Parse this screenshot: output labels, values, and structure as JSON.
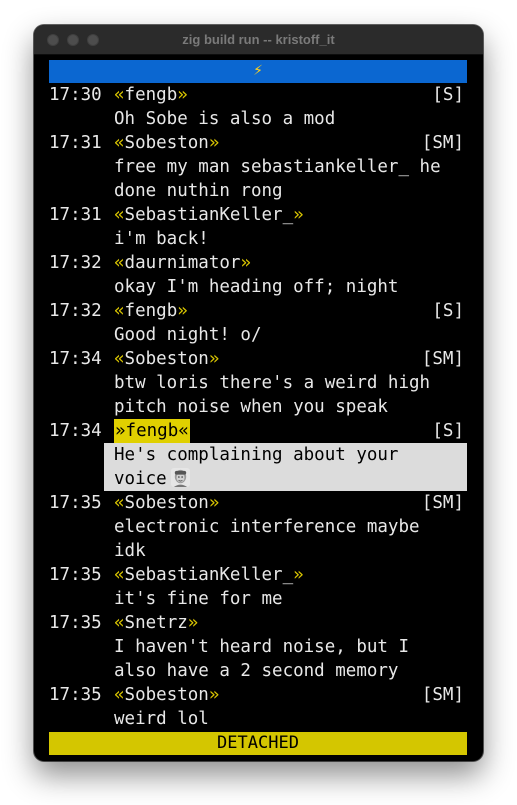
{
  "window": {
    "title": "zig build run -- kristoff_it"
  },
  "top_bar": {
    "icon": "⚡",
    "icon_name": "lightning-icon",
    "color": "#0b67d1"
  },
  "messages": [
    {
      "time": "17:30",
      "nick": "fengb",
      "badge": "[S]",
      "lines": [
        "Oh Sobe is also a mod"
      ]
    },
    {
      "time": "17:31",
      "nick": "Sobeston",
      "badge": "[SM]",
      "lines": [
        "free my man sebastiankeller_ he",
        "done nuthin rong"
      ]
    },
    {
      "time": "17:31",
      "nick": "SebastianKeller_",
      "badge": "",
      "lines": [
        "i'm back!"
      ]
    },
    {
      "time": "17:32",
      "nick": "daurnimator",
      "badge": "",
      "lines": [
        "okay I'm heading off; night"
      ]
    },
    {
      "time": "17:32",
      "nick": "fengb",
      "badge": "[S]",
      "lines": [
        "Good night! o/"
      ]
    },
    {
      "time": "17:34",
      "nick": "Sobeston",
      "badge": "[SM]",
      "lines": [
        "btw loris there's a weird high",
        "pitch noise when you speak"
      ]
    },
    {
      "time": "17:34",
      "nick": "fengb",
      "badge": "[S]",
      "highlighted": true,
      "lines": [
        "He's complaining about your",
        "voice"
      ]
    },
    {
      "time": "17:35",
      "nick": "Sobeston",
      "badge": "[SM]",
      "lines": [
        "electronic interference maybe",
        "idk"
      ]
    },
    {
      "time": "17:35",
      "nick": "SebastianKeller_",
      "badge": "",
      "lines": [
        "it's fine for me"
      ]
    },
    {
      "time": "17:35",
      "nick": "Snetrz",
      "badge": "",
      "lines": [
        "I haven't heard noise, but I",
        "also have a 2 second memory"
      ]
    },
    {
      "time": "17:35",
      "nick": "Sobeston",
      "badge": "[SM]",
      "lines": [
        "weird lol"
      ]
    }
  ],
  "status_bar": {
    "label": "DETACHED",
    "color": "#d4c600"
  },
  "colors": {
    "background": "#000000",
    "text": "#e8e8e8",
    "nick_quotes": "#d8c400",
    "highlight_nick_bg": "#e0d000",
    "highlight_message_bg": "#dcdcdc"
  }
}
